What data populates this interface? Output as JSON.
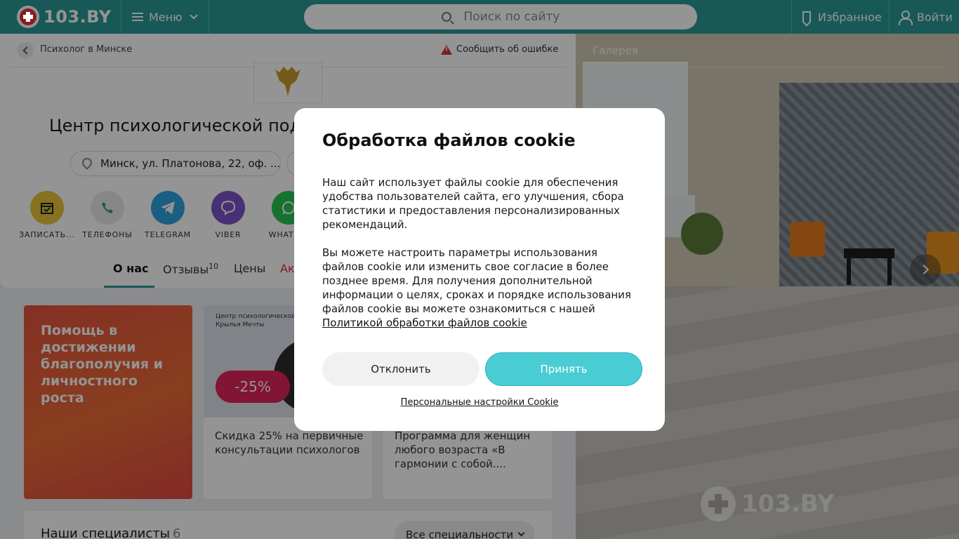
{
  "header": {
    "logo_text": "103.BY",
    "menu_label": "Меню",
    "search_placeholder": "Поиск по сайту",
    "favorites_label": "Избранное",
    "login_label": "Войти"
  },
  "breadcrumb": {
    "back_label": "Психолог в Минске"
  },
  "report_label": "Сообщить об ошибке",
  "org": {
    "title": "Центр психологической поддержки",
    "address": "Минск, ул. Платонова, 22, оф. ..."
  },
  "actions": [
    {
      "label": "ЗАПИСАТЬ...",
      "icon": "calendar-icon",
      "color": "#e7c43a"
    },
    {
      "label": "ТЕЛЕФОНЫ",
      "icon": "phone-icon",
      "color": "#e8e8e8"
    },
    {
      "label": "TELEGRAM",
      "icon": "telegram-icon",
      "color": "#2ea4de"
    },
    {
      "label": "VIBER",
      "icon": "viber-icon",
      "color": "#7a55c8"
    },
    {
      "label": "WHATS...",
      "icon": "whatsapp-icon",
      "color": "#26c452"
    }
  ],
  "tabs": {
    "about": "О нас",
    "reviews": "Отзывы",
    "reviews_count": "10",
    "prices": "Цены",
    "promos": "Ак"
  },
  "promo": {
    "text": "Помощь в достижении благополучия и личностного роста"
  },
  "cards": [
    {
      "small": "Центр психологической\nКрылья Мечты",
      "badge": "-25%",
      "text": "Скидка 25% на первичные консультации психологов"
    },
    {
      "text": "Программа для женщин любого возраста «В гармонии с собой...."
    }
  ],
  "specialists": {
    "title": "Наши специалисты",
    "count": "6",
    "filter": "Все специальности"
  },
  "gallery": {
    "title": "Галерея",
    "watermark": "103.BY"
  },
  "cookie": {
    "title": "Обработка файлов cookie",
    "p1": "Наш сайт использует файлы cookie для обеспечения удобства пользователей сайта, его улучшения, сбора статистики и предоставления персонализированных рекомендаций.",
    "p2": "Вы можете настроить параметры использования файлов cookie или изменить свое согласие в более позднее время. Для получения дополнительной информации о целях, сроках и порядке использования файлов cookie вы можете ознакомиться с нашей",
    "link": "Политикой обработки файлов cookie",
    "decline": "Отклонить",
    "accept": "Принять",
    "settings": "Персональные настройки Cookie"
  },
  "colors": {
    "brand": "#2a9a96",
    "accent": "#49ccd4",
    "danger": "#d8313a"
  }
}
